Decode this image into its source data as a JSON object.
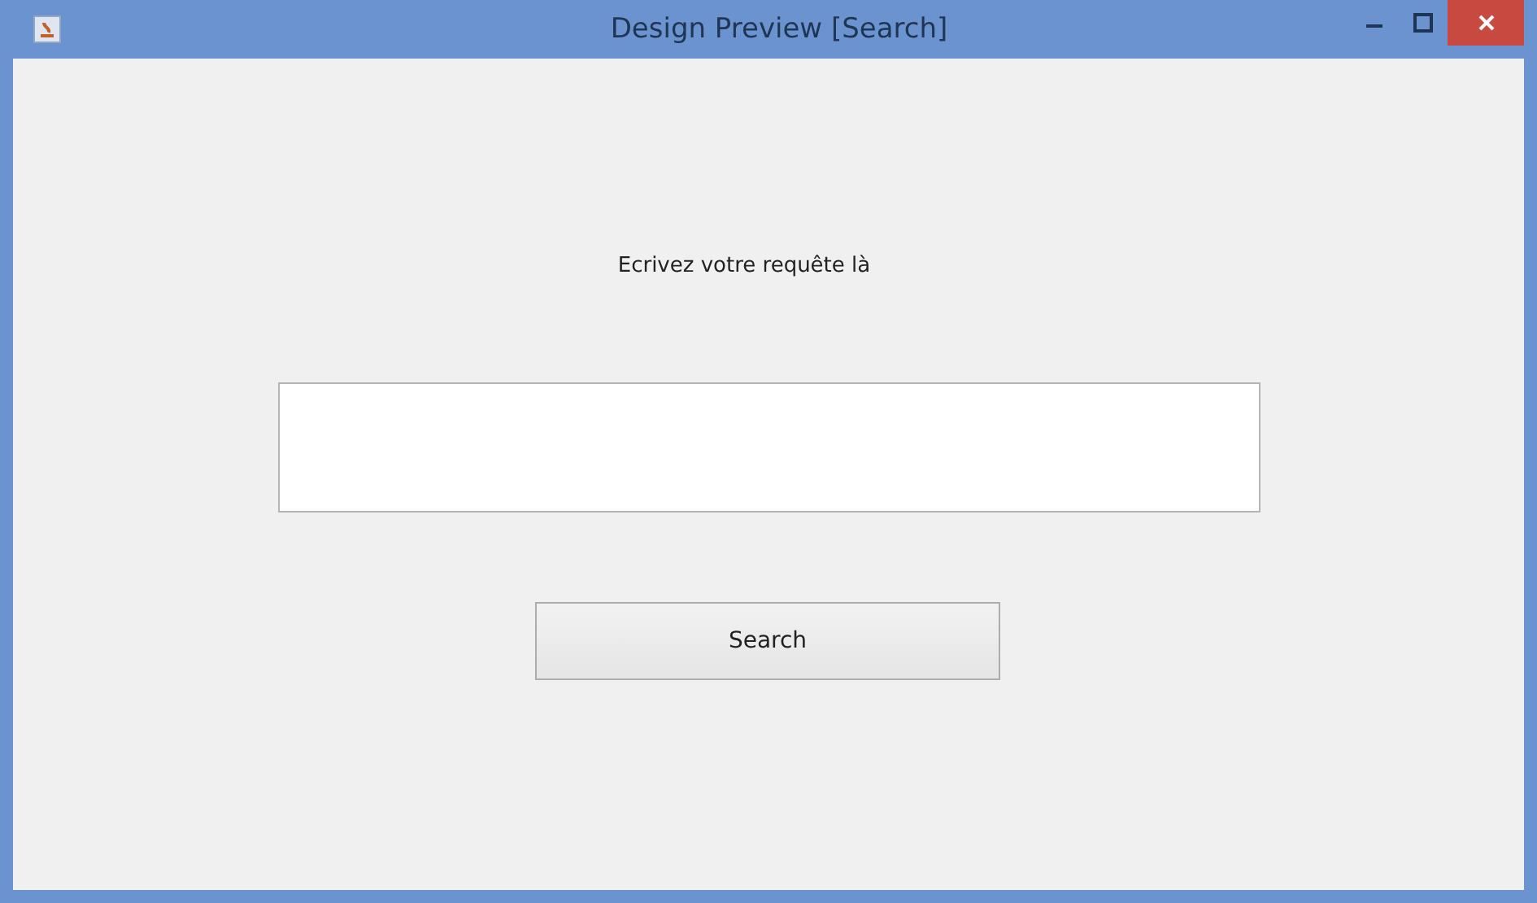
{
  "window": {
    "title": "Design Preview [Search]"
  },
  "prompt": "Ecrivez votre requête là",
  "button": "Search"
}
